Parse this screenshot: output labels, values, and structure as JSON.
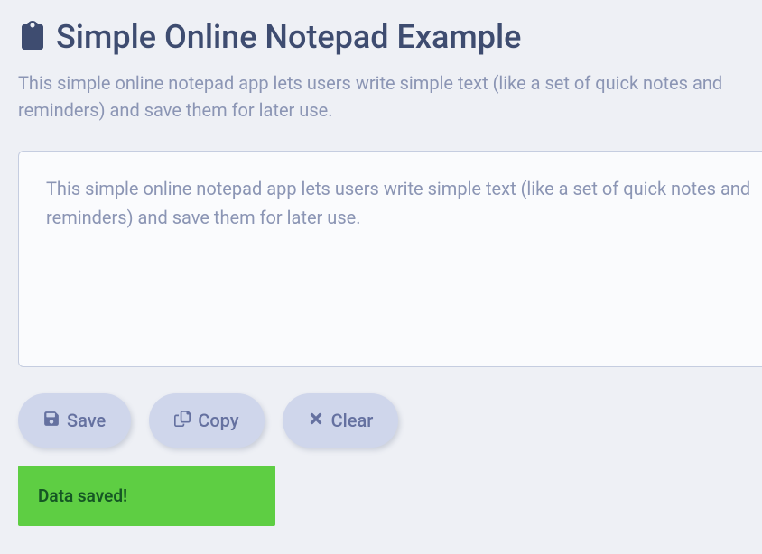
{
  "header": {
    "title": "Simple Online Notepad Example"
  },
  "description": "This simple online notepad app lets users write simple text (like a set of quick notes and reminders) and save them for later use.",
  "notepad": {
    "value": "This simple online notepad app lets users write simple text (like a set of quick notes and reminders) and save them for later use."
  },
  "buttons": {
    "save": "Save",
    "copy": "Copy",
    "clear": "Clear"
  },
  "status": {
    "message": "Data saved!"
  }
}
